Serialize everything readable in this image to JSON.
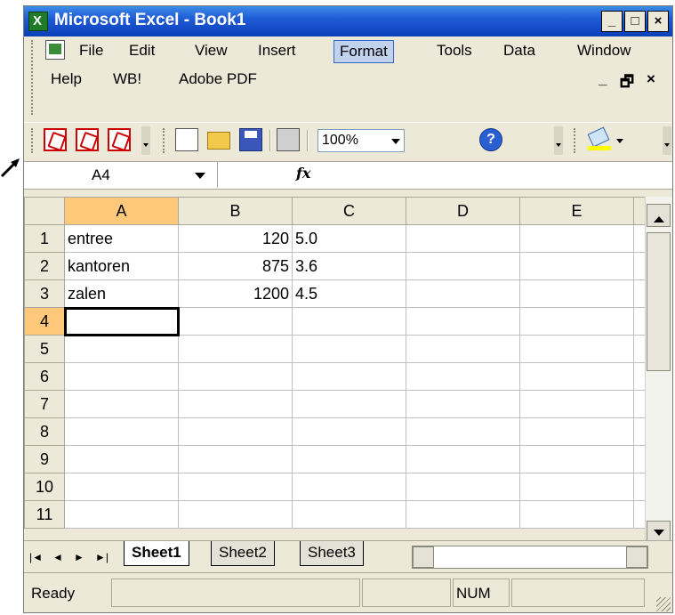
{
  "window": {
    "title": "Microsoft Excel - Book1",
    "minimize": "_",
    "maximize": "□",
    "close": "×"
  },
  "menu": {
    "row1": [
      "File",
      "Edit",
      "View",
      "Insert",
      "Format",
      "Tools",
      "Data",
      "Window"
    ],
    "row2": [
      "Help",
      "WB!",
      "Adobe PDF"
    ],
    "active": "Format",
    "doc_min": "_",
    "doc_restore": "🗗",
    "doc_close": "×"
  },
  "toolbar": {
    "zoom": "100%",
    "help_icon": "?"
  },
  "formula_bar": {
    "name_box": "A4",
    "fx": "fx",
    "value": ""
  },
  "sheet": {
    "columns": [
      "A",
      "B",
      "C",
      "D",
      "E"
    ],
    "rows": [
      {
        "n": "1",
        "a": "entree",
        "b": "120",
        "c": "5.0"
      },
      {
        "n": "2",
        "a": "kantoren",
        "b": "875",
        "c": "3.6"
      },
      {
        "n": "3",
        "a": "zalen",
        "b": "1200",
        "c": "4.5"
      },
      {
        "n": "4",
        "a": "",
        "b": "",
        "c": ""
      },
      {
        "n": "5",
        "a": "",
        "b": "",
        "c": ""
      },
      {
        "n": "6",
        "a": "",
        "b": "",
        "c": ""
      },
      {
        "n": "7",
        "a": "",
        "b": "",
        "c": ""
      },
      {
        "n": "8",
        "a": "",
        "b": "",
        "c": ""
      },
      {
        "n": "9",
        "a": "",
        "b": "",
        "c": ""
      },
      {
        "n": "10",
        "a": "",
        "b": "",
        "c": ""
      },
      {
        "n": "11",
        "a": "",
        "b": "",
        "c": ""
      }
    ],
    "active_cell": "A4"
  },
  "tabs": [
    "Sheet1",
    "Sheet2",
    "Sheet3"
  ],
  "tab_active": "Sheet1",
  "tab_nav": [
    "|◄",
    "◄",
    "►",
    "►|"
  ],
  "status": {
    "text": "Ready",
    "num": "NUM"
  }
}
